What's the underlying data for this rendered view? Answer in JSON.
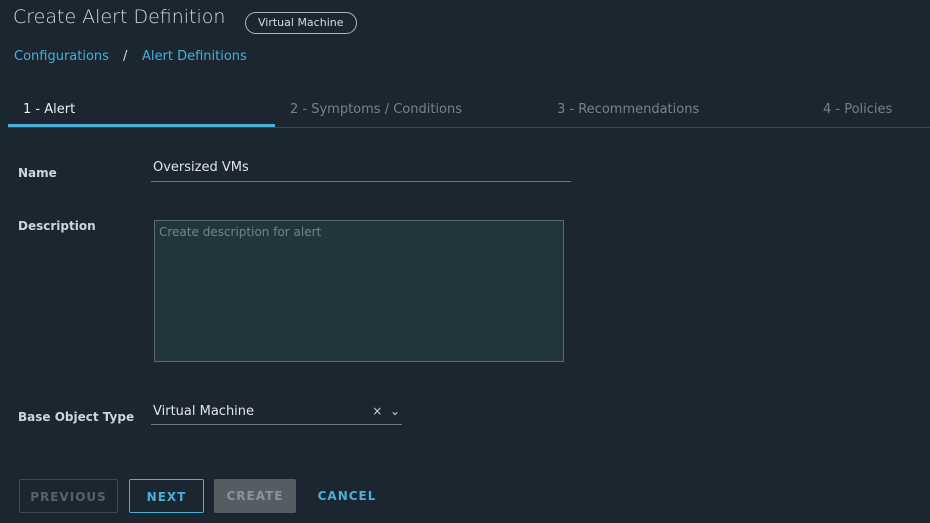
{
  "header": {
    "title": "Create Alert Definition",
    "badge": "Virtual Machine"
  },
  "breadcrumb": {
    "items": [
      "Configurations",
      "Alert Definitions"
    ],
    "separator": "/"
  },
  "tabs": [
    {
      "label": "1 - Alert",
      "active": true
    },
    {
      "label": "2 - Symptoms / Conditions"
    },
    {
      "label": "3 - Recommendations"
    },
    {
      "label": "4 - Policies"
    }
  ],
  "form": {
    "name_label": "Name",
    "name_value": "Oversized VMs",
    "description_label": "Description",
    "description_placeholder": "Create description for alert",
    "base_label": "Base Object Type",
    "base_value": "Virtual Machine",
    "clear_icon": "×",
    "chevron_icon": "⌄"
  },
  "buttons": {
    "previous": "PREVIOUS",
    "next": "NEXT",
    "create": "CREATE",
    "cancel": "CANCEL"
  },
  "colors": {
    "accent": "#49afd9",
    "background": "#1b2631"
  }
}
